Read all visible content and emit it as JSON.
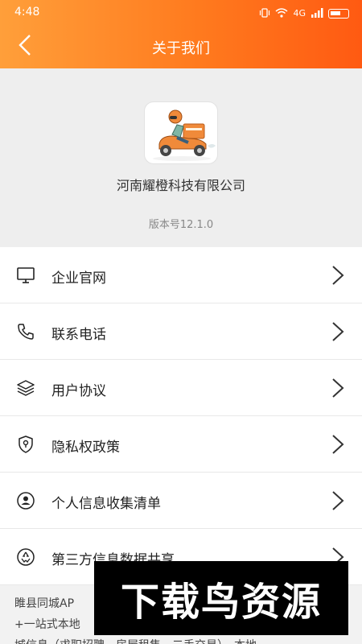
{
  "status_bar": {
    "time": "4:48",
    "network": "4G"
  },
  "nav": {
    "title": "关于我们"
  },
  "about": {
    "company": "河南耀橙科技有限公司",
    "version": "版本号12.1.0",
    "app_icon": "delivery-scooter-logo"
  },
  "menu": {
    "items": [
      {
        "label": "企业官网",
        "icon": "monitor-icon"
      },
      {
        "label": "联系电话",
        "icon": "phone-icon"
      },
      {
        "label": "用户协议",
        "icon": "layers-icon"
      },
      {
        "label": "隐私权政策",
        "icon": "shield-icon"
      },
      {
        "label": "个人信息收集清单",
        "icon": "user-circle-icon"
      },
      {
        "label": "第三方信息数据共享",
        "icon": "recycle-icon"
      }
    ]
  },
  "description": {
    "line1": "睢县同城AP",
    "line2": "+一站式本地",
    "line3": "城信息（求职招聘、房屋租售、二手交易），本地"
  },
  "watermark": {
    "text": "下载鸟资源"
  },
  "colors": {
    "header_start": "#ff9f3a",
    "header_end": "#ff5a12"
  }
}
